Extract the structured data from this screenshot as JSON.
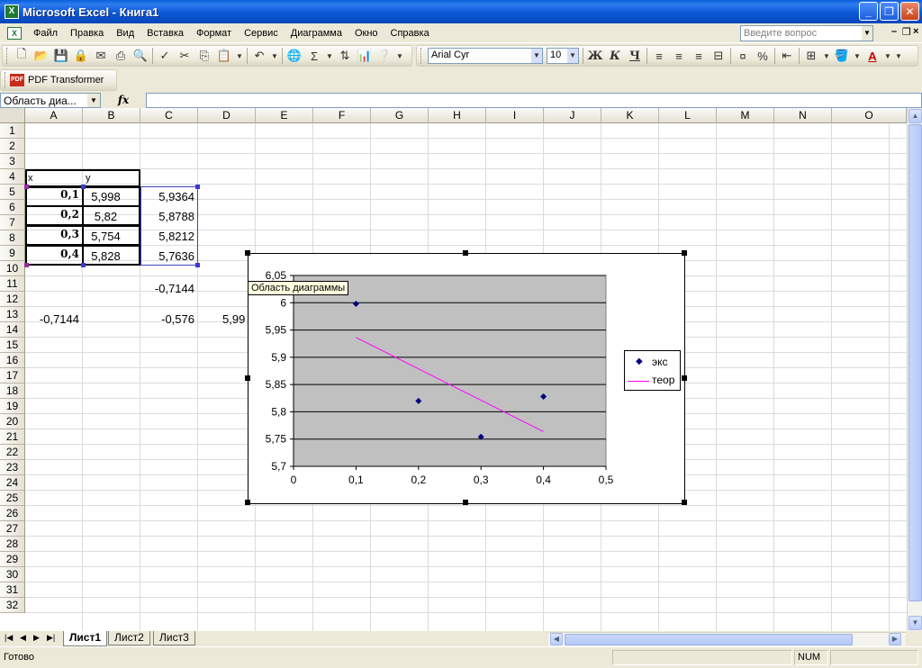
{
  "window": {
    "title": "Microsoft Excel - Книга1",
    "app_icon": "X"
  },
  "menu": {
    "items": [
      "Файл",
      "Правка",
      "Вид",
      "Вставка",
      "Формат",
      "Сервис",
      "Диаграмма",
      "Окно",
      "Справка"
    ],
    "help_placeholder": "Введите вопрос"
  },
  "toolbar": {
    "font_name": "Arial Cyr",
    "font_size": "10",
    "bold": "Ж",
    "italic": "К",
    "underline": "Ч",
    "sigma": "Σ",
    "percent": "%",
    "font_color_letter": "A"
  },
  "pdf_bar": {
    "label": "PDF Transformer",
    "icon_text": "PDF"
  },
  "formula_bar": {
    "name_box": "Область диа...",
    "fx": "fx"
  },
  "columns": [
    "A",
    "B",
    "C",
    "D",
    "E",
    "F",
    "G",
    "H",
    "I",
    "J",
    "K",
    "L",
    "M",
    "N",
    "O"
  ],
  "rows": [
    "1",
    "2",
    "3",
    "4",
    "5",
    "6",
    "7",
    "8",
    "9",
    "10",
    "11",
    "12",
    "13",
    "14",
    "15",
    "16",
    "17",
    "18",
    "19",
    "20",
    "21",
    "22",
    "23",
    "24",
    "25",
    "26",
    "27",
    "28",
    "29",
    "30",
    "31",
    "32"
  ],
  "cells": {
    "A4": "x",
    "B4": "y",
    "A5": "0,1",
    "B5": "5,998",
    "C5": "5,9364",
    "A6": "0,2",
    "B6": "5,82",
    "C6": "5,8788",
    "A7": "0,3",
    "B7": "5,754",
    "C7": "5,8212",
    "A8": "0,4",
    "B8": "5,828",
    "C8": "5,7636",
    "C10": "-0,7144",
    "A12": "-0,7144",
    "C12": "-0,576",
    "D12": "5,99"
  },
  "chart_tooltip": "Область диаграммы",
  "chart_data": {
    "type": "scatter",
    "series": [
      {
        "name": "экс",
        "style": "markers",
        "color": "#000080",
        "x": [
          0.1,
          0.2,
          0.3,
          0.4
        ],
        "y": [
          5.998,
          5.82,
          5.754,
          5.828
        ]
      },
      {
        "name": "теор",
        "style": "line",
        "color": "#ff00ff",
        "x": [
          0.1,
          0.2,
          0.3,
          0.4
        ],
        "y": [
          5.9364,
          5.8788,
          5.8212,
          5.7636
        ]
      }
    ],
    "x_ticks": [
      "0",
      "0,1",
      "0,2",
      "0,3",
      "0,4",
      "0,5"
    ],
    "y_ticks": [
      "5,7",
      "5,75",
      "5,8",
      "5,85",
      "5,9",
      "5,95",
      "6",
      "6,05"
    ],
    "xlim": [
      0,
      0.5
    ],
    "ylim": [
      5.7,
      6.05
    ],
    "plot_background": "#c0c0c0",
    "grid": "horizontal",
    "legend": "right"
  },
  "sheets": [
    "Лист1",
    "Лист2",
    "Лист3"
  ],
  "active_sheet": "Лист1",
  "status": {
    "text": "Готово",
    "num": "NUM"
  }
}
